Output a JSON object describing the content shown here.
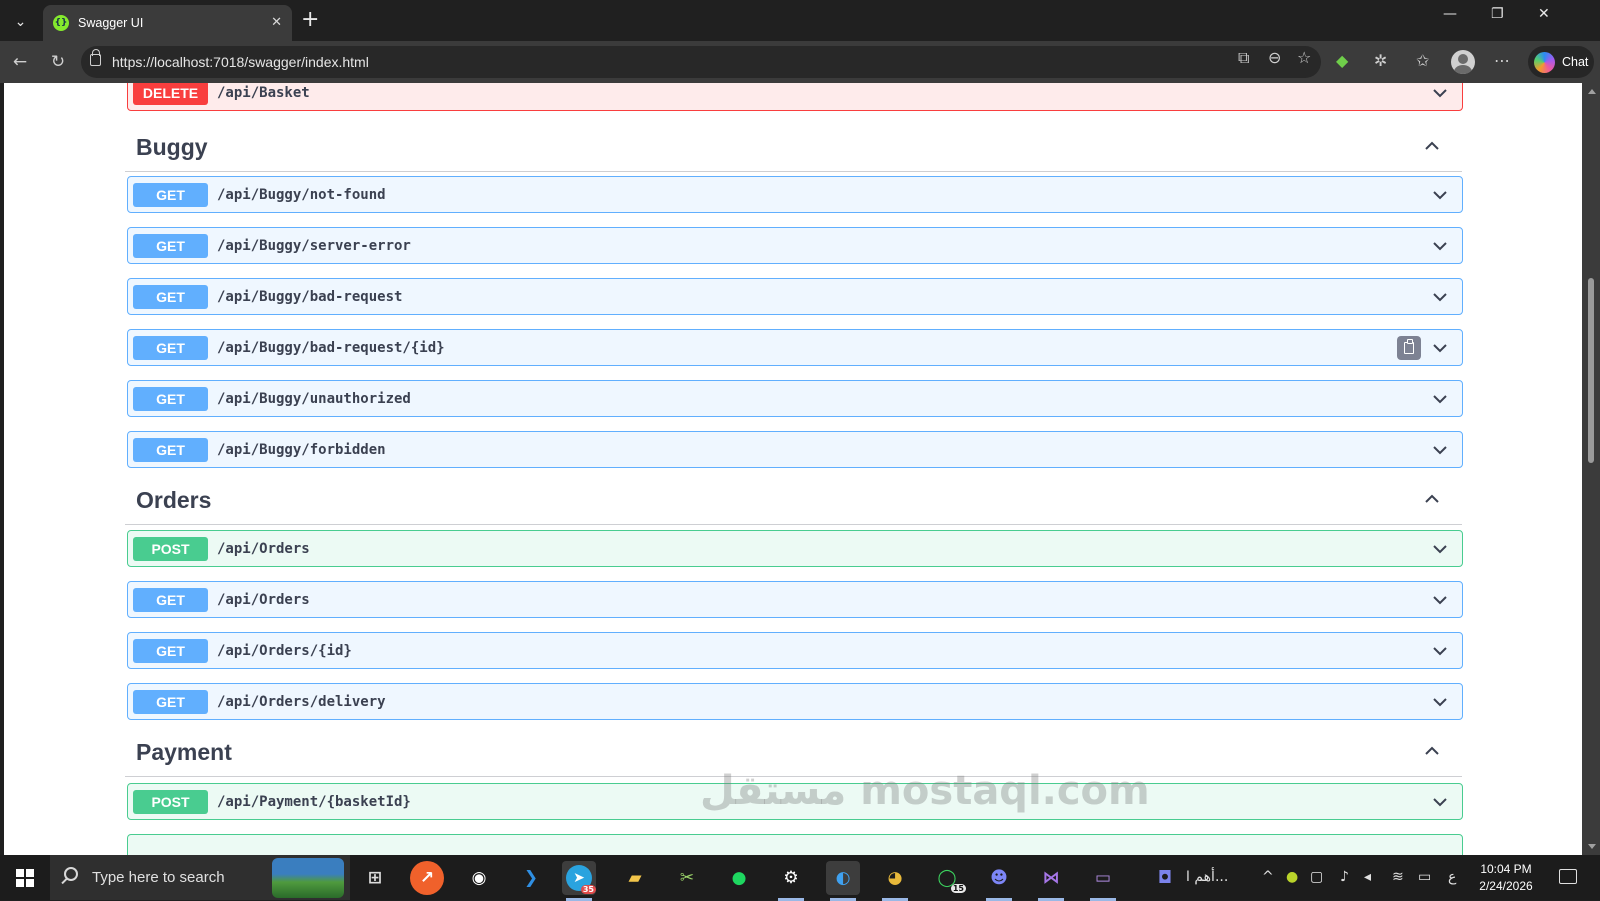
{
  "browser": {
    "tab_title": "Swagger UI",
    "url": "https://localhost:7018/swagger/index.html",
    "chat_label": "Chat"
  },
  "swagger": {
    "sections": [
      {
        "name": "Buggy",
        "operations": [
          {
            "method": "GET",
            "path": "/api/Buggy/not-found"
          },
          {
            "method": "GET",
            "path": "/api/Buggy/server-error"
          },
          {
            "method": "GET",
            "path": "/api/Buggy/bad-request"
          },
          {
            "method": "GET",
            "path": "/api/Buggy/bad-request/{id}"
          },
          {
            "method": "GET",
            "path": "/api/Buggy/unauthorized"
          },
          {
            "method": "GET",
            "path": "/api/Buggy/forbidden"
          }
        ]
      },
      {
        "name": "Orders",
        "operations": [
          {
            "method": "POST",
            "path": "/api/Orders"
          },
          {
            "method": "GET",
            "path": "/api/Orders"
          },
          {
            "method": "GET",
            "path": "/api/Orders/{id}"
          },
          {
            "method": "GET",
            "path": "/api/Orders/delivery"
          }
        ]
      },
      {
        "name": "Payment",
        "operations": [
          {
            "method": "POST",
            "path": "/api/Payment/{basketId}"
          }
        ]
      }
    ],
    "top_operation": {
      "method": "DELETE",
      "path": "/api/Basket"
    }
  },
  "watermark": "مستقل mostaql.com",
  "taskbar": {
    "search_placeholder": "Type here to search",
    "telegram_badge": "35",
    "whatsapp_badge": "15",
    "arabic_label": "أهم ا...",
    "time": "10:04 PM",
    "date": "2/24/2026",
    "lang": "ع"
  },
  "colors": {
    "get": "#61affe",
    "post": "#49cc90",
    "delete": "#f93e3e",
    "text": "#3b4151"
  }
}
